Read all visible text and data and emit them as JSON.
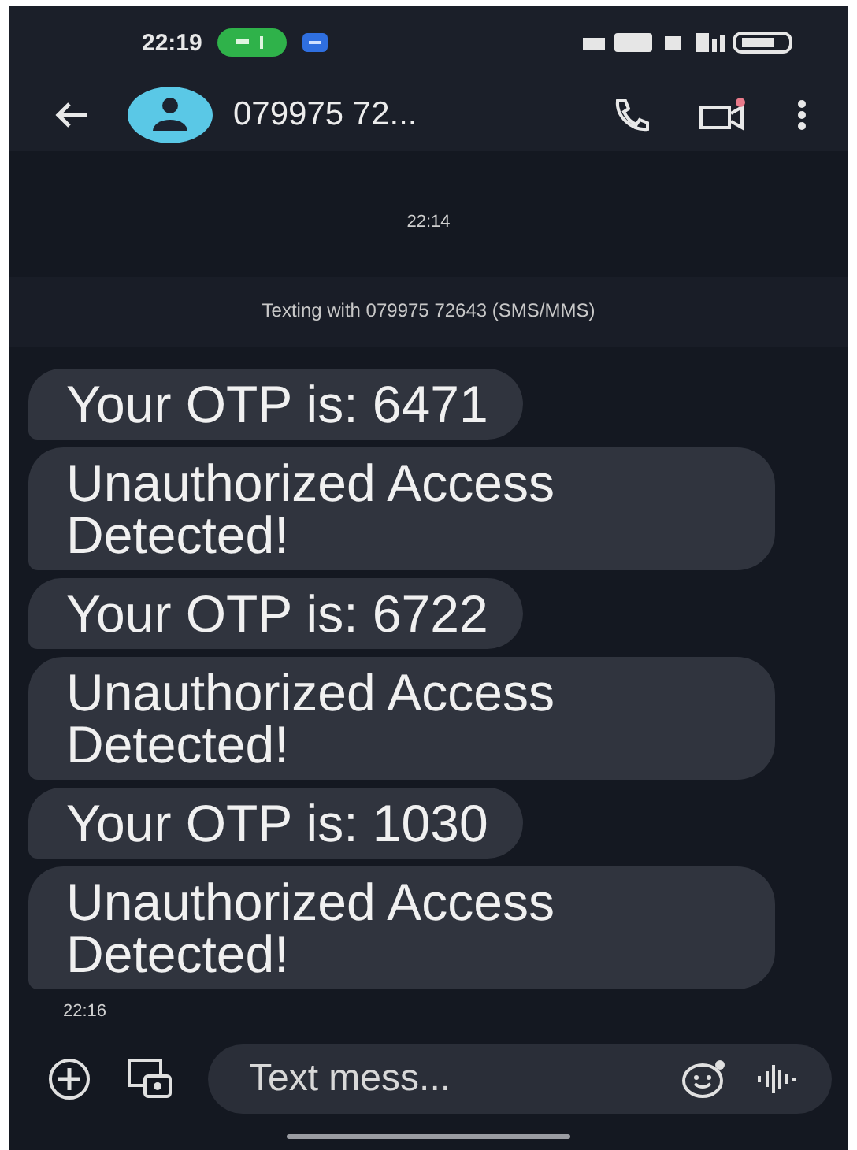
{
  "status_bar": {
    "time": "22:19"
  },
  "header": {
    "contact": "079975 72..."
  },
  "conversation": {
    "date_time": "22:14",
    "banner": "Texting with 079975 72643 (SMS/MMS)",
    "messages": [
      {
        "text": "Your OTP is: 6471"
      },
      {
        "text": "Unauthorized Access Detected!"
      },
      {
        "text": "Your OTP is: 6722"
      },
      {
        "text": "Unauthorized Access Detected!"
      },
      {
        "text": "Your OTP is: 1030"
      },
      {
        "text": "Unauthorized Access Detected!"
      }
    ],
    "last_time": "22:16"
  },
  "composer": {
    "placeholder": "Text mess..."
  }
}
